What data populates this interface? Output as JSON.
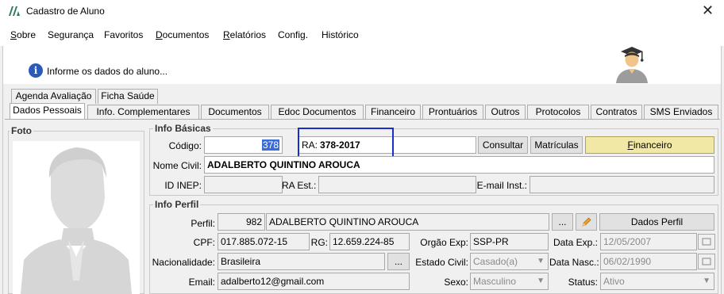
{
  "window": {
    "title": "Cadastro de Aluno",
    "close_glyph": "✕"
  },
  "menu": {
    "items": [
      {
        "first": "S",
        "rest": "obre"
      },
      {
        "first": "",
        "rest": "Segurança"
      },
      {
        "first": "",
        "rest": "Favoritos"
      },
      {
        "first": "D",
        "rest": "ocumentos"
      },
      {
        "first": "R",
        "rest": "elatórios"
      },
      {
        "first": "",
        "rest": "Config."
      },
      {
        "first": "",
        "rest": "Histórico"
      }
    ]
  },
  "banner": {
    "message": "Informe os dados do aluno...",
    "info_glyph": "i"
  },
  "tabs": {
    "row1": [
      "Agenda Avaliação",
      "Ficha Saúde"
    ],
    "row2": [
      "Dados Pessoais",
      "Info. Complementares",
      "Documentos",
      "Edoc Documentos",
      "Financeiro",
      "Prontuários",
      "Outros",
      "Protocolos",
      "Contratos",
      "SMS Enviados"
    ]
  },
  "foto": {
    "legend": "Foto"
  },
  "info_basicas": {
    "legend": "Info Básicas",
    "codigo_label": "Código:",
    "codigo_value": "378",
    "ra_label": "RA:",
    "ra_value": "378-2017",
    "consultar": "Consultar",
    "matriculas": "Matrículas",
    "financeiro_first": "F",
    "financeiro_rest": "inanceiro",
    "nome_civil_label": "Nome Civil:",
    "nome_civil_value": "ADALBERTO QUINTINO AROUCA",
    "id_inep_label": "ID INEP:",
    "ra_est_label": "RA Est.:",
    "email_inst_label": "E-mail Inst.:"
  },
  "info_perfil": {
    "legend": "Info Perfil",
    "perfil_label": "Perfil:",
    "perfil_id": "982",
    "perfil_nome": "ADALBERTO QUINTINO AROUCA",
    "ellipsis": "...",
    "dados_perfil": "Dados Perfil",
    "cpf_label": "CPF:",
    "cpf_value": "017.885.072-15",
    "rg_label": "RG:",
    "rg_value": "12.659.224-85",
    "orgao_label": "Orgão Exp:",
    "orgao_value": "SSP-PR",
    "data_exp_label": "Data Exp.:",
    "data_exp_value": "12/05/2007",
    "nacionalidade_label": "Nacionalidade:",
    "nacionalidade_value": "Brasileira",
    "estado_civil_label": "Estado Civil:",
    "estado_civil_value": "Casado(a)",
    "data_nasc_label": "Data Nasc.:",
    "data_nasc_value": "06/02/1990",
    "email_label": "Email:",
    "email_value": "adalberto12@gmail.com",
    "sexo_label": "Sexo:",
    "sexo_value": "Masculino",
    "status_label": "Status:",
    "status_value": "Ativo",
    "dropdown_glyph": "▼"
  },
  "colors": {
    "highlight_border": "#1a2fc9",
    "gold_button": "#f1e8a6",
    "selection": "#3a6cd8"
  }
}
